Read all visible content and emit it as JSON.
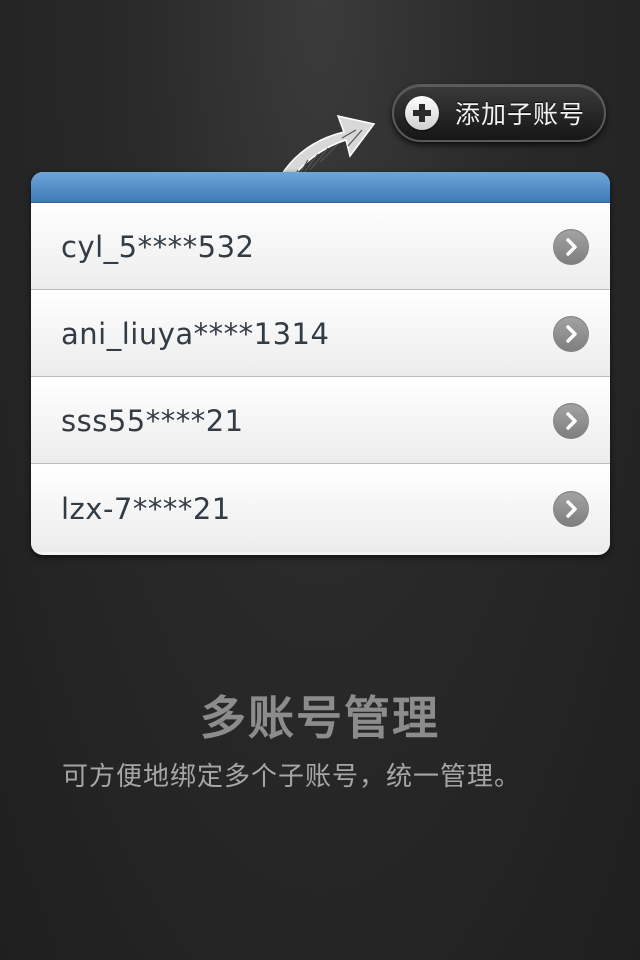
{
  "add_button": {
    "label": "添加子账号",
    "icon": "plus-icon"
  },
  "accounts": [
    {
      "name": "cyl_5****532",
      "icon": "chevron-right-icon"
    },
    {
      "name": "ani_liuya****1314",
      "icon": "chevron-right-icon"
    },
    {
      "name": "sss55****21",
      "icon": "chevron-right-icon"
    },
    {
      "name": "lzx-7****21",
      "icon": "chevron-right-icon"
    }
  ],
  "feature": {
    "title": "多账号管理",
    "description": "可方便地绑定多个子账号，统一管理。"
  },
  "colors": {
    "background": "#242424",
    "header_blue": "#4f8cc8",
    "text_dark": "#333b45",
    "text_gray": "#8c8c8c"
  }
}
